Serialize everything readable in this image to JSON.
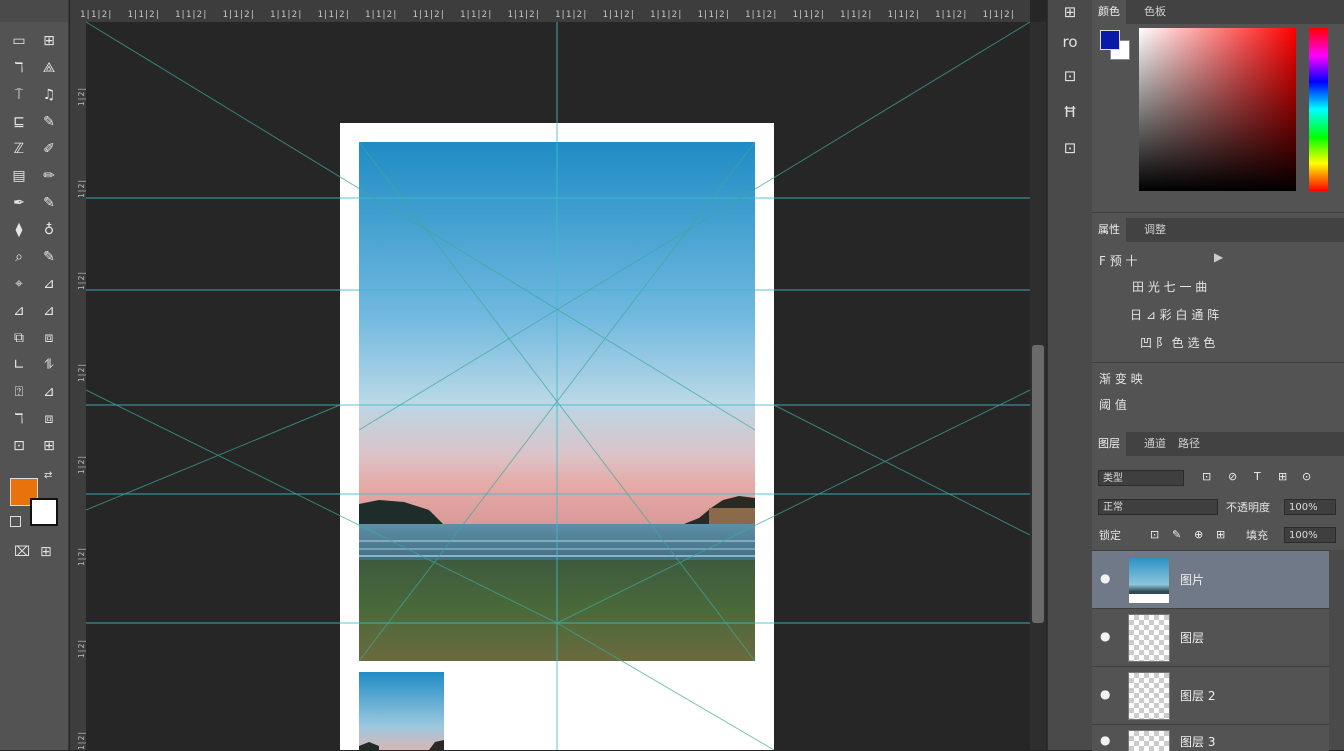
{
  "toolbox": {
    "tools": [
      [
        "▭",
        "⊞"
      ],
      [
        "ℸ",
        "⟁"
      ],
      [
        "⍑",
        "♫"
      ],
      [
        "⊑",
        "✎"
      ],
      [
        "ℤ",
        "✐"
      ],
      [
        "▤",
        "✏"
      ],
      [
        "✒",
        "✎"
      ],
      [
        "⧫",
        "♁"
      ],
      [
        "⌕",
        "✎"
      ],
      [
        "⌖",
        "⊿"
      ],
      [
        "⊿",
        "⊿"
      ],
      [
        "⧉",
        "⧈"
      ],
      [
        "∟",
        "⥮"
      ],
      [
        "⍰",
        "⊿"
      ],
      [
        "ℸ",
        "⧈"
      ],
      [
        "⊡",
        "⊞"
      ]
    ],
    "foreground_color": "#e8730c",
    "background_color": "#ffffff",
    "swap_icon": "⇄",
    "quickmask_icon": "⌧",
    "screenmode_icon": "⊞"
  },
  "ruler_top_labels": [
    "1|1|2|",
    "1|1|2|",
    "1|1|2|",
    "1|1|2|",
    "1|1|2|",
    "1|1|2|",
    "1|1|2|",
    "1|1|2|",
    "1|1|2|",
    "1|1|2|",
    "1|1|2|",
    "1|1|2|",
    "1|1|2|",
    "1|1|2|",
    "1|1|2|",
    "1|1|2|",
    "1|1|2|",
    "1|1|2|",
    "1|1|2|",
    "1|1|2|"
  ],
  "ruler_left_labels": [
    "1|2|",
    "1|2|",
    "1|2|",
    "1|2|",
    "1|2|",
    "1|2|",
    "1|2|",
    "1|2|"
  ],
  "dock_icons": [
    "⊞",
    "ro",
    "⊡",
    "Ħ",
    "⊡"
  ],
  "color_panel": {
    "tabs": [
      "颜色",
      "色板"
    ],
    "foreground": "#0a1aa8",
    "background": "#ffffff"
  },
  "adjust_panel": {
    "tabs": [
      "属性",
      "调整"
    ],
    "row1": "F 预 十",
    "row1_icon": "▶",
    "row2": "田 光 七 一 曲",
    "row3": "日 ⊿ 彩 白 通 阵",
    "row4": "凹 阝 色 选 色",
    "row5": "渐 变 映",
    "row6": "阈 值"
  },
  "layers_panel": {
    "tabs": [
      "图层",
      "通道",
      "路径"
    ],
    "filter_label": "类型",
    "blend_mode": "正常",
    "opacity_label": "不透明度",
    "opacity_value": "100%",
    "lock_label": "锁定",
    "fill_label": "填充",
    "fill_value": "100%",
    "filter_icons": [
      "⊡",
      "⊘",
      "T",
      "⊞",
      "⊙"
    ],
    "lock_icons": [
      "⊡",
      "✎",
      "⊕",
      "⊞"
    ],
    "layers": [
      {
        "name": "图片",
        "selected": true,
        "photo": true
      },
      {
        "name": "图层",
        "selected": false,
        "photo": false
      },
      {
        "name": "图层 2",
        "selected": false,
        "photo": false
      },
      {
        "name": "图层 3",
        "selected": false,
        "photo": false
      }
    ]
  }
}
